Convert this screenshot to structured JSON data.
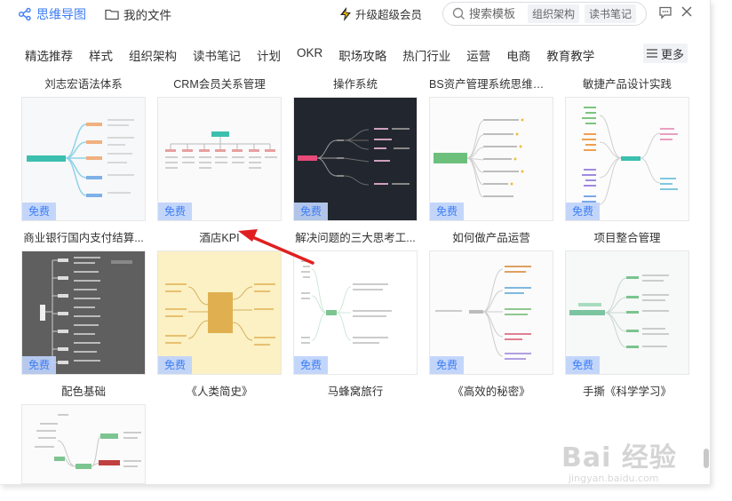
{
  "header": {
    "brand_label": "思维导图",
    "myfiles_label": "我的文件",
    "upgrade_label": "升级超级会员",
    "search_placeholder": "搜索模板",
    "search_chips": [
      "组织架构",
      "读书笔记"
    ]
  },
  "categories": [
    "精选推荐",
    "样式",
    "组织架构",
    "读书笔记",
    "计划",
    "OKR",
    "职场攻略",
    "热门行业",
    "运营",
    "电商",
    "教育教学"
  ],
  "more_label": "更多",
  "free_label": "免费",
  "templates": [
    {
      "title": "刘志宏语法体系",
      "theme": "light-teal",
      "free": true
    },
    {
      "title": "CRM会员关系管理",
      "theme": "table",
      "free": true
    },
    {
      "title": "操作系统",
      "theme": "dark",
      "free": true
    },
    {
      "title": "BS资产管理系统思维导图",
      "theme": "green-list",
      "free": true
    },
    {
      "title": "敏捷产品设计实践",
      "theme": "colorful-tree",
      "free": true
    },
    {
      "title": "商业银行国内支付结算...",
      "theme": "gray-dark",
      "free": true
    },
    {
      "title": "酒店KPI",
      "theme": "yellow",
      "free": true
    },
    {
      "title": "解决问题的三大思考工...",
      "theme": "white-green",
      "free": true
    },
    {
      "title": "如何做产品运营",
      "theme": "multi-color",
      "free": true
    },
    {
      "title": "项目整合管理",
      "theme": "light-green",
      "free": true
    },
    {
      "title": "配色基础",
      "theme": "color-basics",
      "free": false
    },
    {
      "title": "《人类简史》",
      "theme": "none",
      "free": false
    },
    {
      "title": "马蜂窝旅行",
      "theme": "none",
      "free": false
    },
    {
      "title": "《高效的秘密》",
      "theme": "none",
      "free": false
    },
    {
      "title": "手撕《科学学习》",
      "theme": "none",
      "free": false
    }
  ],
  "watermark": {
    "main": "Bai 经验",
    "sub": "jingyan.baidu.com"
  }
}
